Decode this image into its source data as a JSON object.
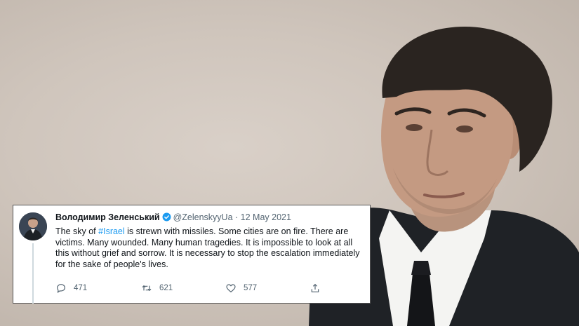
{
  "tweet": {
    "author_name": "Володимир Зеленський",
    "handle": "@ZelenskyyUa",
    "separator": "·",
    "date": "12 May 2021",
    "text_before_hashtag": "The sky of ",
    "hashtag": "#Israel",
    "text_after_hashtag": " is strewn with missiles. Some cities are on fire. There are victims. Many wounded. Many human tragedies. It is impossible to look at all this without grief and sorrow. It is necessary to stop the escalation immediately for the sake of people's lives.",
    "replies": "471",
    "retweets": "621",
    "likes": "577"
  },
  "icons": {
    "verified": "verified-badge-icon",
    "reply": "reply-icon",
    "retweet": "retweet-icon",
    "like": "like-icon",
    "share": "share-icon"
  },
  "colors": {
    "accent": "#1d9bf0",
    "text_primary": "#0f1419",
    "text_secondary": "#536471",
    "background_wall": "#d3cac1",
    "suit": "#1f2226"
  }
}
